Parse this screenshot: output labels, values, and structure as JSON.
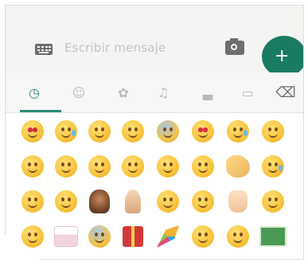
{
  "input": {
    "placeholder": "Escribir mensaje"
  },
  "tabs": [
    {
      "icon": "clock-icon",
      "glyph": "◷",
      "active": true
    },
    {
      "icon": "smiley-icon",
      "glyph": "☺",
      "active": false
    },
    {
      "icon": "flower-icon",
      "glyph": "✿",
      "active": false
    },
    {
      "icon": "bell-icon",
      "glyph": "♫",
      "active": false
    },
    {
      "icon": "car-icon",
      "glyph": "▃",
      "active": false
    },
    {
      "icon": "symbols-icon",
      "glyph": "▭",
      "active": false
    },
    {
      "icon": "backspace-icon",
      "glyph": "⌫",
      "active": false
    }
  ],
  "send_glyph": "+",
  "colors": {
    "accent": "#2b8a73",
    "send_button": "#1b7a62",
    "input_bar": "#f4f4f2"
  },
  "emoji_rows": [
    [
      "kissing-heart-face",
      "grinning-sweat-face",
      "confounded-face",
      "smiling-face",
      "screaming-fear-face",
      "heart-eyes-face",
      "sweat-face",
      "grimacing-face"
    ],
    [
      "winking-tongue-face",
      "relieved-face",
      "weary-face",
      "flushed-face",
      "surprised-face",
      "neutral-face",
      "clapping-hands",
      "crying-face"
    ],
    [
      "grinning-face",
      "tongue-face",
      "woman-tipping-hand",
      "folded-hands",
      "laughing-face",
      "pensive-face",
      "thumbs-down",
      "persevering-face"
    ],
    [
      "sleepy-face",
      "birthday-cake",
      "astonished-face",
      "wrapped-gift",
      "party-popper",
      "tired-face",
      "smiling-face-2",
      "money-bill"
    ]
  ]
}
